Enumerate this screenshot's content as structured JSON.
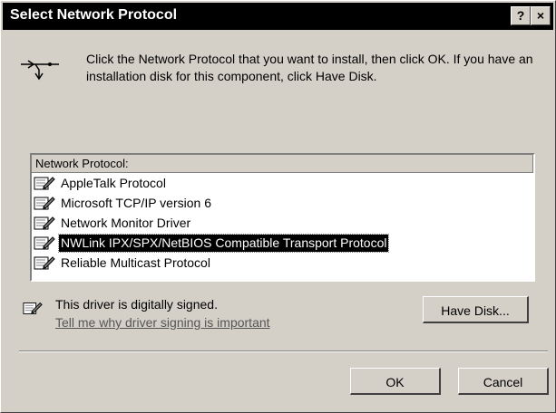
{
  "window": {
    "title": "Select Network Protocol",
    "help_label": "?",
    "close_label": "×"
  },
  "instructions": "Click the Network Protocol that you want to install, then click OK. If you have an installation disk for this component, click Have Disk.",
  "list": {
    "header": "Network Protocol:",
    "items": [
      {
        "label": "AppleTalk Protocol",
        "icon": "protocol-icon",
        "selected": false
      },
      {
        "label": "Microsoft TCP/IP version 6",
        "icon": "protocol-icon",
        "selected": false
      },
      {
        "label": "Network Monitor Driver",
        "icon": "protocol-icon",
        "selected": false
      },
      {
        "label": "NWLink IPX/SPX/NetBIOS Compatible Transport Protocol",
        "icon": "protocol-icon",
        "selected": true
      },
      {
        "label": "Reliable Multicast Protocol",
        "icon": "protocol-icon",
        "selected": false
      }
    ]
  },
  "signing": {
    "icon": "signed-driver-icon",
    "text": "This driver is digitally signed.",
    "link": "Tell me why driver signing is important"
  },
  "buttons": {
    "have_disk": "Have Disk...",
    "ok": "OK",
    "cancel": "Cancel"
  }
}
